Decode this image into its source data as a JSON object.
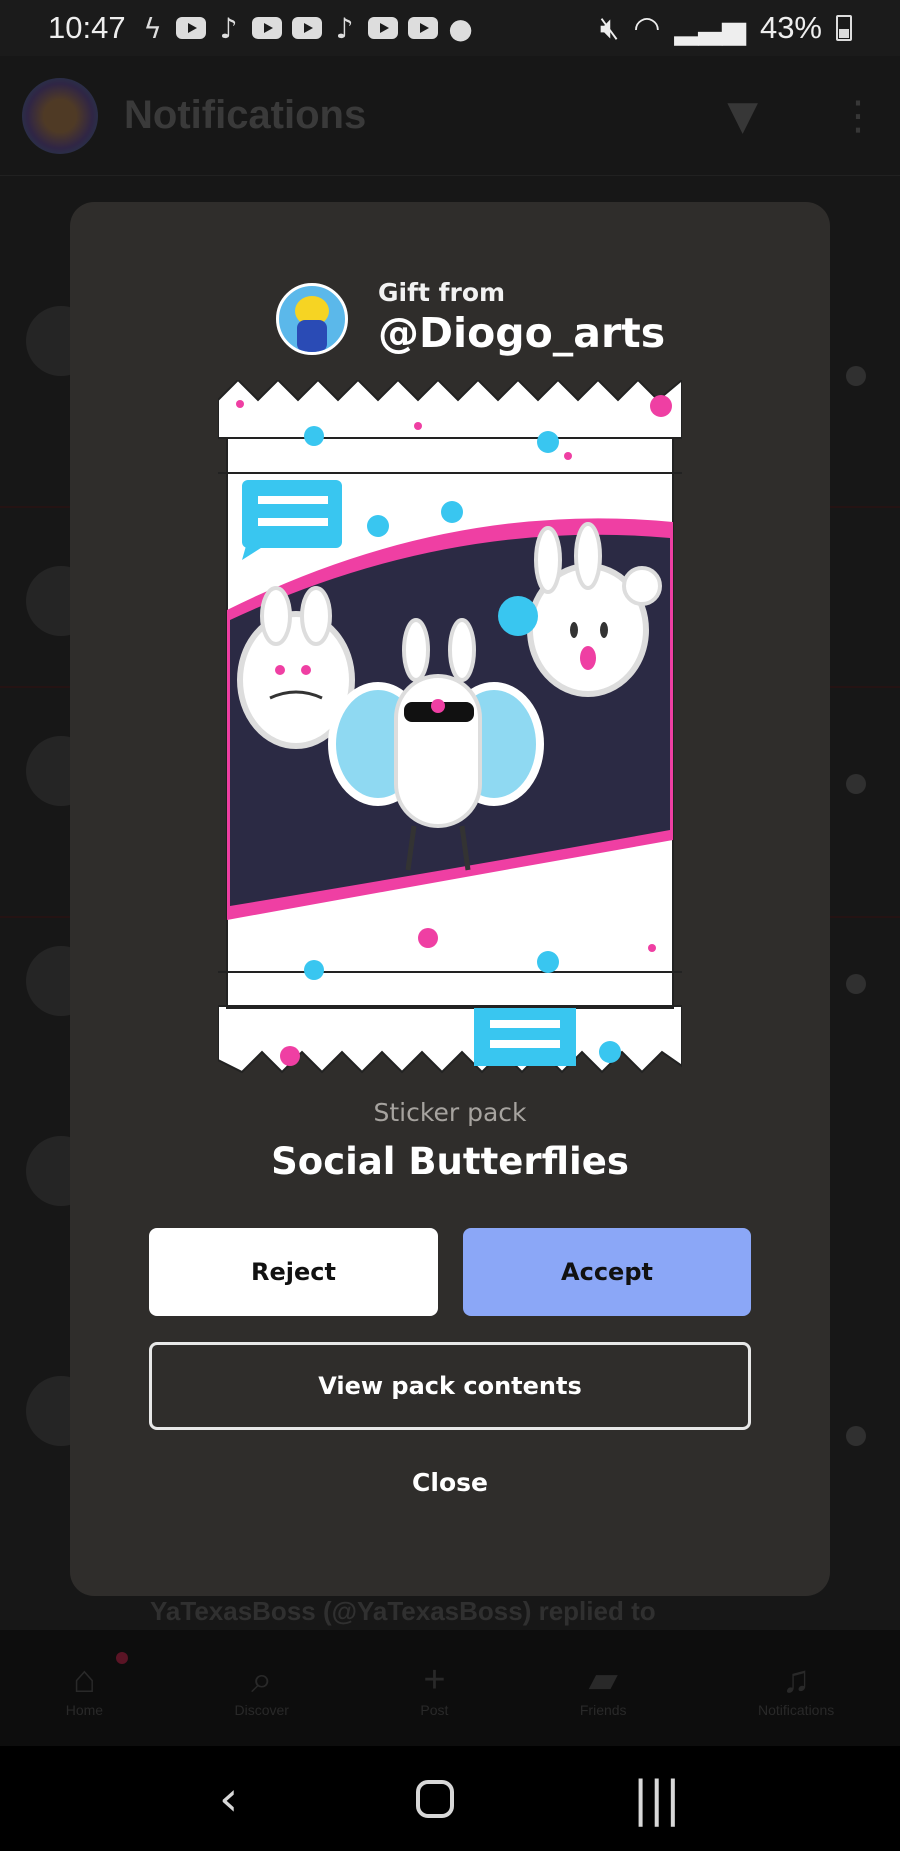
{
  "status_bar": {
    "time": "10:47",
    "battery": "43%"
  },
  "background_app": {
    "title": "Notifications",
    "bottom_preview": "YaTexasBoss (@YaTexasBoss) replied to",
    "tabs": [
      {
        "label": "Home",
        "icon": "home-icon"
      },
      {
        "label": "Discover",
        "icon": "search-icon"
      },
      {
        "label": "Post",
        "icon": "plus-icon"
      },
      {
        "label": "Friends",
        "icon": "chat-icon"
      },
      {
        "label": "Notifications",
        "icon": "bell-icon"
      }
    ]
  },
  "modal": {
    "gift_label": "Gift from",
    "gift_user": "@Diogo_arts",
    "pack_type": "Sticker pack",
    "pack_name": "Social Butterflies",
    "reject_label": "Reject",
    "accept_label": "Accept",
    "view_label": "View pack contents",
    "close_label": "Close"
  },
  "colors": {
    "modal_bg": "#2f2d2b",
    "accept_bg": "#8ba7f7",
    "pack_pink": "#ef3fa3",
    "pack_cyan": "#39c6f0",
    "pack_dark": "#2b2a44"
  }
}
